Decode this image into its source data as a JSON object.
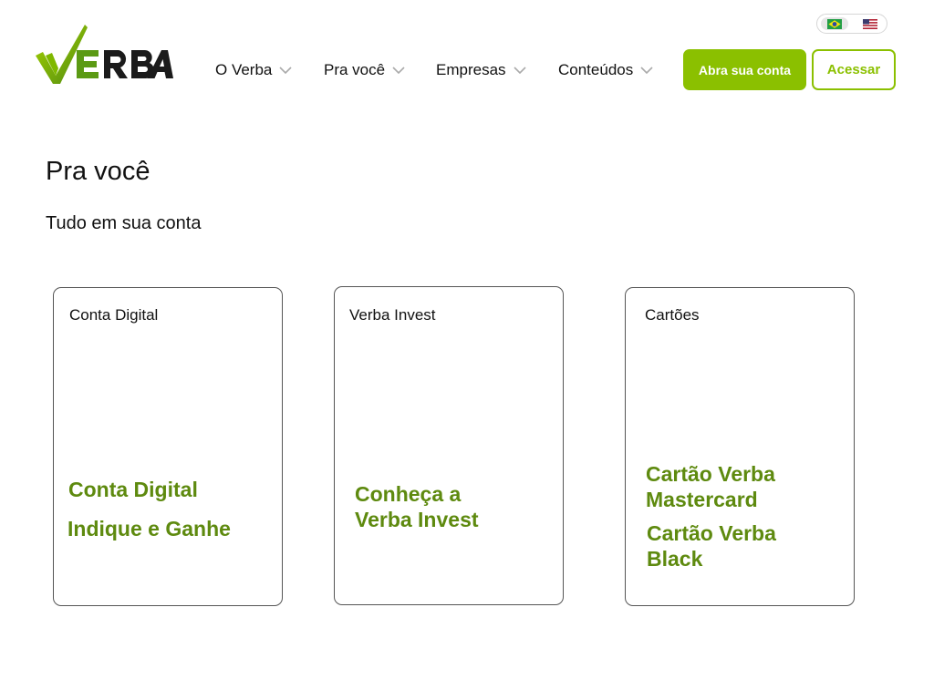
{
  "brand": {
    "logo_text": "VERBA",
    "colors": {
      "accent": "#8bc000",
      "link_green": "#5e8a0f",
      "logo_dark": "#111111"
    }
  },
  "language_switch": {
    "options": [
      {
        "name": "Português",
        "icon": "brazil-flag-icon",
        "selected": true
      },
      {
        "name": "English",
        "icon": "us-flag-icon",
        "selected": false
      }
    ]
  },
  "nav": {
    "items": [
      {
        "label": "O Verba",
        "icon": "chevron-down-icon"
      },
      {
        "label": "Pra você",
        "icon": "chevron-down-icon"
      },
      {
        "label": "Empresas",
        "icon": "chevron-down-icon"
      },
      {
        "label": "Conteúdos",
        "icon": "chevron-down-icon"
      }
    ],
    "open_account_label": "Abra sua conta",
    "login_label": "Acessar"
  },
  "main": {
    "title": "Pra você",
    "subtitle": "Tudo em sua conta",
    "cards": [
      {
        "title": "Conta Digital",
        "links": [
          "Conta Digital",
          "Indique e Ganhe"
        ]
      },
      {
        "title": "Verba Invest",
        "links": [
          "Conheça a\nVerba Invest"
        ]
      },
      {
        "title": "Cartões",
        "links": [
          "Cartão Verba\nMastercard",
          "Cartão Verba\nBlack"
        ]
      }
    ]
  }
}
